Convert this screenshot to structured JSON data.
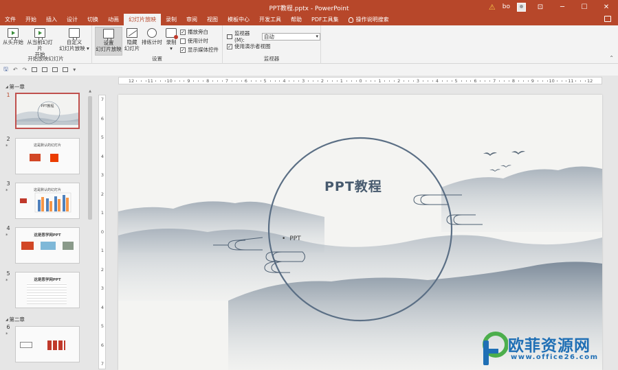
{
  "window": {
    "title": "PPT教程.pptx  -  PowerPoint",
    "user": "bo",
    "warn_icon": "warning-icon",
    "buttons": {
      "minimize": "─",
      "restore": "☐",
      "close": "✕",
      "ribbon_display": "⊡"
    }
  },
  "tabs": [
    {
      "label": "文件"
    },
    {
      "label": "开始"
    },
    {
      "label": "插入"
    },
    {
      "label": "设计"
    },
    {
      "label": "切换"
    },
    {
      "label": "动画"
    },
    {
      "label": "幻灯片放映"
    },
    {
      "label": "录制"
    },
    {
      "label": "审阅"
    },
    {
      "label": "视图"
    },
    {
      "label": "模板中心"
    },
    {
      "label": "开发工具"
    },
    {
      "label": "帮助"
    },
    {
      "label": "PDF工具集"
    }
  ],
  "active_tab": "幻灯片放映",
  "tellme": "操作说明搜索",
  "ribbon": {
    "group_start": {
      "label": "开始放映幻灯片",
      "from_start": "从头开始",
      "from_current_1": "从当前幻灯片",
      "from_current_2": "开始",
      "custom_1": "自定义",
      "custom_2": "幻灯片放映 ▾"
    },
    "group_setup": {
      "label": "设置",
      "setup_1": "设置",
      "setup_2": "幻灯片放映",
      "hide_1": "隐藏",
      "hide_2": "幻灯片",
      "rehearse": "排练计时",
      "record_1": "录制",
      "record_2": "▾",
      "narration": "播放旁白",
      "timings": "使用计时",
      "media_controls": "显示媒体控件",
      "check": "✓"
    },
    "group_monitors": {
      "label": "监视器",
      "monitor_label": "监视器(M):",
      "monitor_value": "自动",
      "presenter_view": "使用演示者视图"
    },
    "collapse": "⌃"
  },
  "qat": {
    "save": "🖫",
    "undo": "↶",
    "redo": "↷",
    "more": "▾"
  },
  "thumbnails": {
    "section1": "第一章",
    "section2": "第二章",
    "star": "*",
    "slides": [
      {
        "num": "1",
        "title": "PPT教程"
      },
      {
        "num": "2",
        "title": "这是默认的幻灯片"
      },
      {
        "num": "3",
        "title": "这是默认的幻灯片"
      },
      {
        "num": "4",
        "title": "这是恶学网PPT"
      },
      {
        "num": "5",
        "title": "这是恶学网PPT"
      },
      {
        "num": "6",
        "title": ""
      }
    ]
  },
  "ruler_h": [
    "12",
    "11",
    "10",
    "9",
    "8",
    "7",
    "6",
    "5",
    "4",
    "3",
    "2",
    "1",
    "0",
    "1",
    "2",
    "3",
    "4",
    "5",
    "6",
    "7",
    "8",
    "9",
    "10",
    "11",
    "12"
  ],
  "ruler_v": [
    "7",
    "6",
    "5",
    "4",
    "3",
    "2",
    "1",
    "0",
    "1",
    "2",
    "3",
    "4",
    "5",
    "6",
    "7"
  ],
  "slide": {
    "title": "PPT教程",
    "subtitle": "PPT"
  },
  "watermark": {
    "text": "欧菲资源网",
    "url": "www.office26.com"
  },
  "colors": {
    "accent": "#b7472a",
    "title_blue": "#475a6e",
    "circle": "#5b6f85"
  }
}
